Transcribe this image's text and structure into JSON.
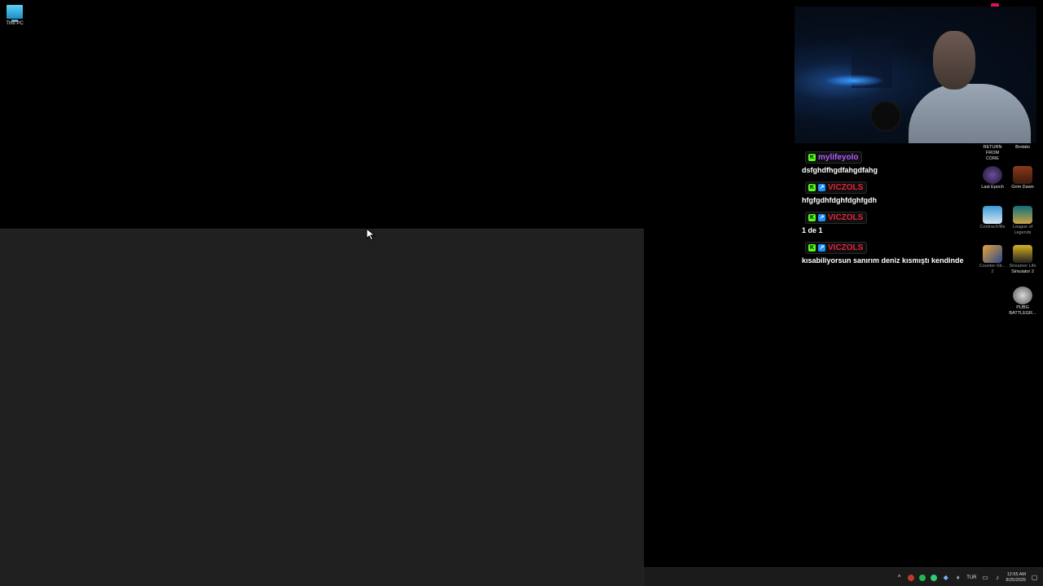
{
  "desktop": {
    "icons": [
      {
        "label": "This PC",
        "icon": "monitor-icon"
      }
    ]
  },
  "chat": {
    "messages": [
      {
        "user": "mylifeyolo",
        "user_color": "#b05cff",
        "text": "dsfghdfhgdfahgdfahg",
        "badges": [
          "kick-badge"
        ]
      },
      {
        "user": "VICZOLS",
        "user_color": "#e8233b",
        "text": "hfgfgdhfdghfdghfgdh",
        "badges": [
          "kick-badge",
          "verified-badge"
        ]
      },
      {
        "user": "VICZOLS",
        "user_color": "#e8233b",
        "text": "1 de 1",
        "badges": [
          "kick-badge",
          "verified-badge"
        ]
      },
      {
        "user": "VICZOLS",
        "user_color": "#e8233b",
        "text": "kısabiliyorsun sanırım deniz kısmıştı kendinde",
        "badges": [
          "kick-badge",
          "verified-badge"
        ]
      }
    ]
  },
  "games": {
    "return_from_core": "RETURN FROM CORE",
    "brotato": "Brotato",
    "last_epoch": "Last Epoch",
    "grim_dawn": "Grim Dawn",
    "contractville": "ContractVille",
    "league_line1": "League of",
    "league_line2": "Legends",
    "counter_line1": "Counter-Str...",
    "counter_line2": "2",
    "streamer_line1": "Streamer Life",
    "streamer_line2": "Simulator 2",
    "pubg_line1": "PUBG",
    "pubg_line2": "BATTLEGR..."
  },
  "taskbar": {
    "language": "TUR",
    "time": "12:55 AM",
    "date": "8/25/2025"
  },
  "colors": {
    "window_bg": "#202020",
    "kick_green": "#53fc18"
  }
}
